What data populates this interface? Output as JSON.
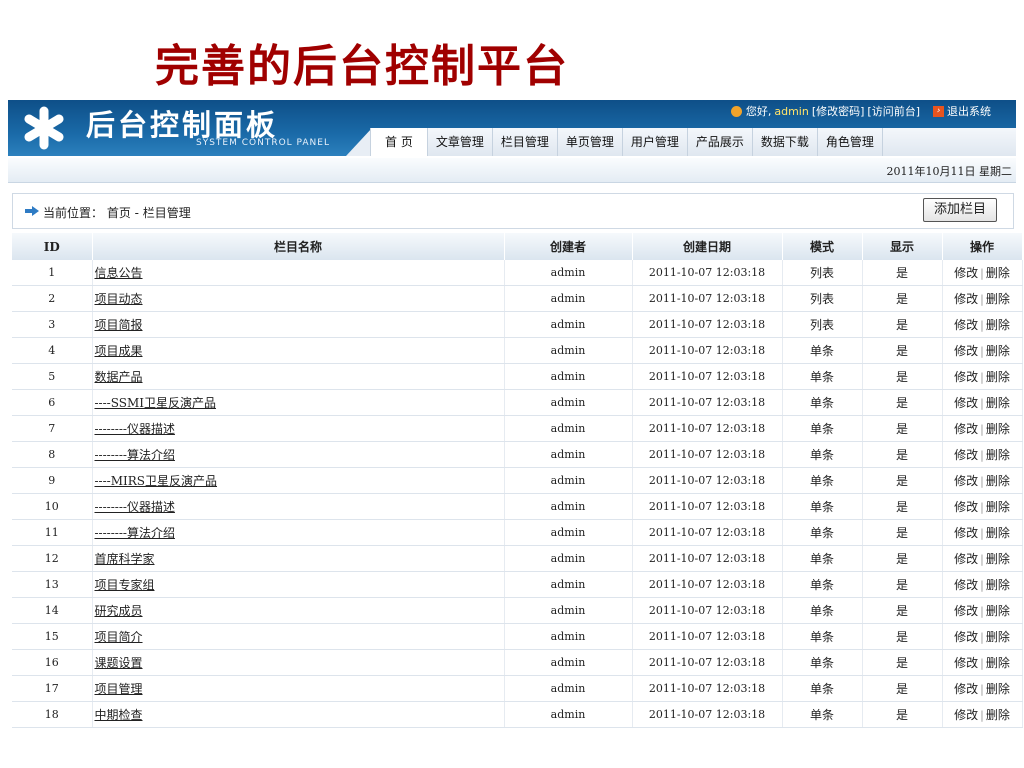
{
  "slide_title": "完善的后台控制平台",
  "header": {
    "title": "后台控制面板",
    "subtitle": "SYSTEM CONTROL PANEL",
    "greeting": "您好,",
    "username": "admin",
    "change_password": "[修改密码]",
    "visit_front": "[访问前台]",
    "logout": "退出系统",
    "nav": [
      "首 页",
      "文章管理",
      "栏目管理",
      "单页管理",
      "用户管理",
      "产品展示",
      "数据下载",
      "角色管理"
    ],
    "date": "2011年10月11日 星期二"
  },
  "breadcrumb": {
    "label": "当前位置：",
    "path": "首页 - 栏目管理"
  },
  "add_button": "添加栏目",
  "table": {
    "headers": [
      "ID",
      "栏目名称",
      "创建者",
      "创建日期",
      "模式",
      "显示",
      "操作"
    ],
    "edit_label": "修改",
    "delete_label": "删除",
    "separator": "|",
    "rows": [
      {
        "id": "1",
        "name": "信息公告",
        "creator": "admin",
        "date": "2011-10-07 12:03:18",
        "mode": "列表",
        "show": "是"
      },
      {
        "id": "2",
        "name": "项目动态",
        "creator": "admin",
        "date": "2011-10-07 12:03:18",
        "mode": "列表",
        "show": "是"
      },
      {
        "id": "3",
        "name": "项目简报",
        "creator": "admin",
        "date": "2011-10-07 12:03:18",
        "mode": "列表",
        "show": "是"
      },
      {
        "id": "4",
        "name": "项目成果",
        "creator": "admin",
        "date": "2011-10-07 12:03:18",
        "mode": "单条",
        "show": "是"
      },
      {
        "id": "5",
        "name": "数据产品",
        "creator": "admin",
        "date": "2011-10-07 12:03:18",
        "mode": "单条",
        "show": "是"
      },
      {
        "id": "6",
        "name": "----SSMI卫星反演产品",
        "creator": "admin",
        "date": "2011-10-07 12:03:18",
        "mode": "单条",
        "show": "是"
      },
      {
        "id": "7",
        "name": "--------仪器描述",
        "creator": "admin",
        "date": "2011-10-07 12:03:18",
        "mode": "单条",
        "show": "是"
      },
      {
        "id": "8",
        "name": "--------算法介绍",
        "creator": "admin",
        "date": "2011-10-07 12:03:18",
        "mode": "单条",
        "show": "是"
      },
      {
        "id": "9",
        "name": "----MIRS卫星反演产品",
        "creator": "admin",
        "date": "2011-10-07 12:03:18",
        "mode": "单条",
        "show": "是"
      },
      {
        "id": "10",
        "name": "--------仪器描述",
        "creator": "admin",
        "date": "2011-10-07 12:03:18",
        "mode": "单条",
        "show": "是"
      },
      {
        "id": "11",
        "name": "--------算法介绍",
        "creator": "admin",
        "date": "2011-10-07 12:03:18",
        "mode": "单条",
        "show": "是"
      },
      {
        "id": "12",
        "name": "首席科学家",
        "creator": "admin",
        "date": "2011-10-07 12:03:18",
        "mode": "单条",
        "show": "是"
      },
      {
        "id": "13",
        "name": "项目专家组",
        "creator": "admin",
        "date": "2011-10-07 12:03:18",
        "mode": "单条",
        "show": "是"
      },
      {
        "id": "14",
        "name": "研究成员",
        "creator": "admin",
        "date": "2011-10-07 12:03:18",
        "mode": "单条",
        "show": "是"
      },
      {
        "id": "15",
        "name": "项目简介",
        "creator": "admin",
        "date": "2011-10-07 12:03:18",
        "mode": "单条",
        "show": "是"
      },
      {
        "id": "16",
        "name": "课题设置",
        "creator": "admin",
        "date": "2011-10-07 12:03:18",
        "mode": "单条",
        "show": "是"
      },
      {
        "id": "17",
        "name": "项目管理",
        "creator": "admin",
        "date": "2011-10-07 12:03:18",
        "mode": "单条",
        "show": "是"
      },
      {
        "id": "18",
        "name": "中期检查",
        "creator": "admin",
        "date": "2011-10-07 12:03:18",
        "mode": "单条",
        "show": "是"
      }
    ]
  },
  "colors": {
    "header_blue": "#1a6aa8",
    "title_red": "#a00000",
    "username": "#ffe36b",
    "logout_icon": "#e8541e"
  }
}
